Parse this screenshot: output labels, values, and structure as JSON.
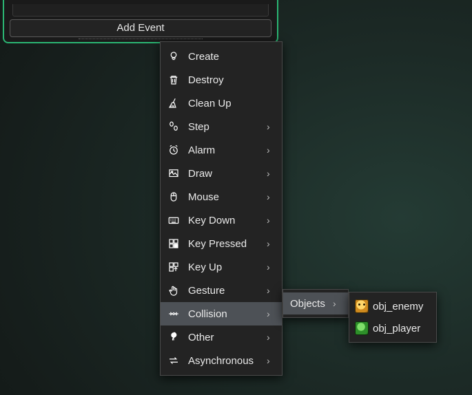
{
  "panel": {
    "add_event_label": "Add Event"
  },
  "menu": {
    "items": [
      {
        "label": "Create",
        "icon": "bulb-icon",
        "submenu": false
      },
      {
        "label": "Destroy",
        "icon": "trash-icon",
        "submenu": false
      },
      {
        "label": "Clean Up",
        "icon": "broom-icon",
        "submenu": false
      },
      {
        "label": "Step",
        "icon": "steps-icon",
        "submenu": true
      },
      {
        "label": "Alarm",
        "icon": "alarm-icon",
        "submenu": true
      },
      {
        "label": "Draw",
        "icon": "draw-icon",
        "submenu": true
      },
      {
        "label": "Mouse",
        "icon": "mouse-icon",
        "submenu": true
      },
      {
        "label": "Key Down",
        "icon": "keyboard-icon",
        "submenu": true
      },
      {
        "label": "Key Pressed",
        "icon": "keypress-icon",
        "submenu": true
      },
      {
        "label": "Key Up",
        "icon": "keyup-icon",
        "submenu": true
      },
      {
        "label": "Gesture",
        "icon": "gesture-icon",
        "submenu": true
      },
      {
        "label": "Collision",
        "icon": "collision-icon",
        "submenu": true,
        "hovered": true
      },
      {
        "label": "Other",
        "icon": "other-icon",
        "submenu": true
      },
      {
        "label": "Asynchronous",
        "icon": "async-icon",
        "submenu": true
      }
    ]
  },
  "submenu1": {
    "items": [
      {
        "label": "Objects",
        "submenu": true,
        "hovered": true
      }
    ]
  },
  "submenu2": {
    "items": [
      {
        "label": "obj_enemy",
        "icon": "obj-enemy-icon"
      },
      {
        "label": "obj_player",
        "icon": "obj-player-icon"
      }
    ]
  }
}
